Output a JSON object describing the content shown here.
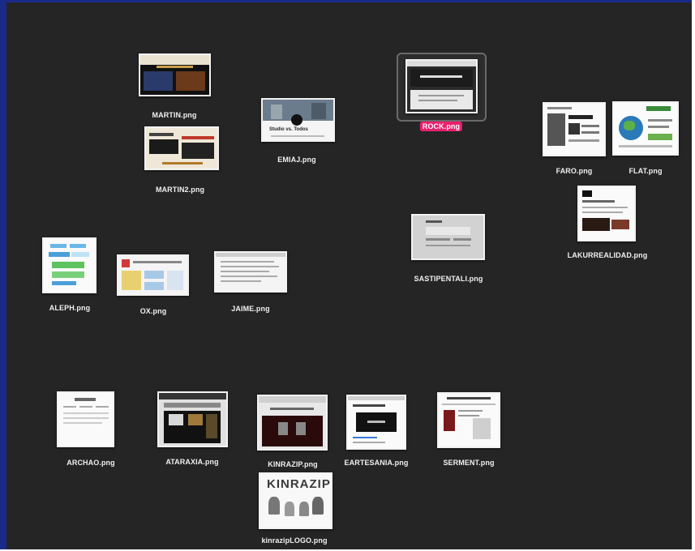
{
  "files": [
    {
      "name": "MARTIN.png",
      "icon": "image-file-icon"
    },
    {
      "name": "MARTIN2.png",
      "icon": "image-file-icon"
    },
    {
      "name": "EMIAJ.png",
      "icon": "image-file-icon"
    },
    {
      "name": "ROCK.png",
      "icon": "image-file-icon",
      "selected": true
    },
    {
      "name": "FARO.png",
      "icon": "image-file-icon"
    },
    {
      "name": "FLAT.png",
      "icon": "image-file-icon"
    },
    {
      "name": "LAKURREALIDAD.png",
      "icon": "image-file-icon"
    },
    {
      "name": "SASTIPENTALI.png",
      "icon": "image-file-icon"
    },
    {
      "name": "ALEPH.png",
      "icon": "image-file-icon"
    },
    {
      "name": "OX.png",
      "icon": "image-file-icon"
    },
    {
      "name": "JAIME.png",
      "icon": "image-file-icon"
    },
    {
      "name": "ARCHAO.png",
      "icon": "image-file-icon"
    },
    {
      "name": "ATARAXIA.png",
      "icon": "image-file-icon"
    },
    {
      "name": "KINRAZIP.png",
      "icon": "image-file-icon"
    },
    {
      "name": "EARTESANIA.png",
      "icon": "image-file-icon"
    },
    {
      "name": "SERMENT.png",
      "icon": "image-file-icon"
    },
    {
      "name": "kinrazipLOGO.png",
      "icon": "image-file-icon"
    }
  ],
  "colors": {
    "desktop": "#252525",
    "window_border": "#1a2a8a",
    "selection_label": "#e8206e"
  },
  "thumb_text": {
    "emiaj": "Studio vs. Todos",
    "kinrazip_logo": "KINRAZIP"
  }
}
